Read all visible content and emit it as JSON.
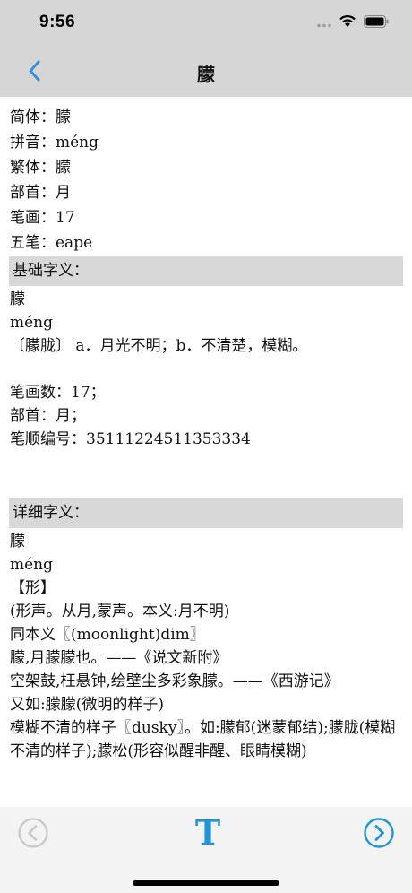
{
  "status": {
    "time": "9:56"
  },
  "nav": {
    "title": "朦"
  },
  "info": [
    "简体：朦",
    "拼音：méng",
    "繁体：朦",
    "部首：月",
    "笔画：17",
    "五笔：eape"
  ],
  "basic": {
    "header": "基础字义：",
    "lines": [
      "朦",
      "méng",
      "〔朦胧〕 a．月光不明；b．不清楚，模糊。",
      "",
      "笔画数：17；",
      "部首：月；",
      "笔顺编号：35111224511353334",
      "",
      ""
    ]
  },
  "detail": {
    "header": "详细字义：",
    "lines": [
      "朦",
      "méng",
      "【形】",
      "(形声。从月,蒙声。本义:月不明)",
      "同本义〖(moonlight)dim〗",
      "朦,月朦朦也。——《说文新附》",
      "空架鼓,枉悬钟,绘壁尘多彩象朦。——《西游记》",
      "又如:朦朦(微明的样子)",
      "模糊不清的样子〖dusky〗。如:朦郁(迷蒙郁结);朦胧(模糊不清的样子);朦松(形容似醒非醒、眼睛模糊)"
    ]
  },
  "toolbar": {
    "font_glyph": "T"
  },
  "colors": {
    "accent": "#1f95d8",
    "disabled": "#c8c8c8",
    "bar": "#d6d6d6"
  }
}
